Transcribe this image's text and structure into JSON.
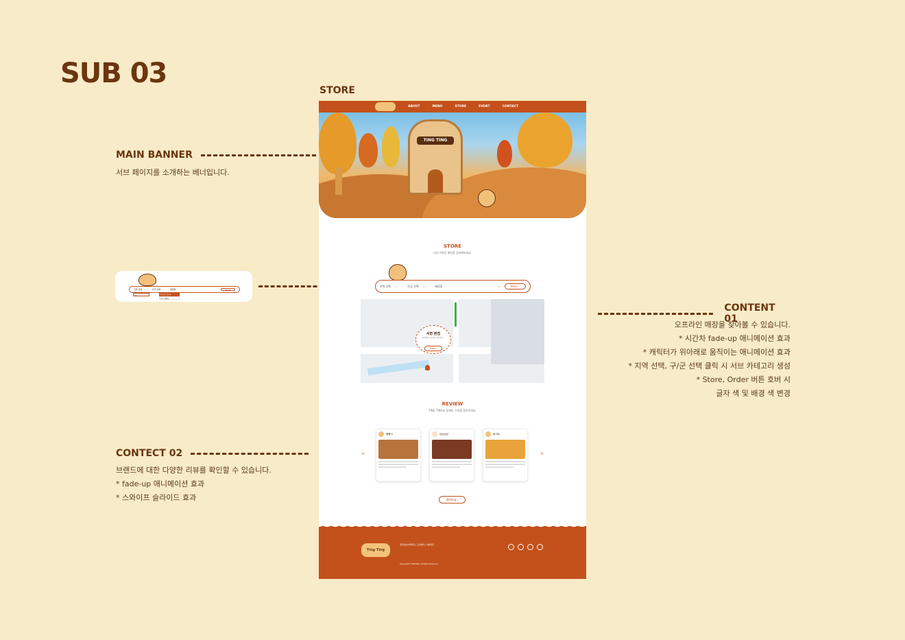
{
  "page": {
    "title": "SUB 03",
    "store_caption": "STORE"
  },
  "annotations": {
    "main_banner": {
      "title": "MAIN BANNER",
      "desc": "서브 페이지를 소개하는 베너입니다."
    },
    "content01": {
      "title": "CONTENT 01",
      "lines": [
        "오프라인 매장을 찾아볼 수 있습니다.",
        "* 시간차 fade-up 애니메이션 효과",
        "* 캐릭터가 위아래로 움직이는 애니메이션 효과",
        "* 지역 선택, 구/군 선택 클릭 시 서브 카테고리 생성",
        "* Store, Order 버튼 호버 시",
        "글자 색 및 배경 색 변경"
      ]
    },
    "contect02": {
      "title": "CONTECT 02",
      "lines": [
        "브랜드에 대한 다양한 리뷰를 확인할 수 있습니다.",
        "* fade-up 애니메이션 효과",
        "* 스와이프 슬라이드 효과"
      ]
    }
  },
  "mockup": {
    "nav": [
      "ABOUT",
      "MENU",
      "STORE",
      "EVENT",
      "CONTACT"
    ],
    "banner_sign": "TING TING",
    "store_section": {
      "title": "STORE",
      "subtitle": "나와 가까운 매장을 검색해보세요."
    },
    "search": {
      "region": "지역 선택",
      "district": "구/군 선택",
      "placeholder": "매장명",
      "button": "Store"
    },
    "map_popup": {
      "name": "서면 본점",
      "addr": "부산광역시 부산진구 전포대로 ...",
      "button": "Order"
    },
    "review_section": {
      "title": "REVIEW",
      "subtitle": "TING TING과 함께한 기억을 알려주세요.",
      "prev": "<",
      "next": ">",
      "write_button": "Writing"
    },
    "reviews": [
      {
        "user": "빵빵이"
      },
      {
        "user": "냠냠냠냠"
      },
      {
        "user": "베그베"
      }
    ],
    "footer": {
      "logo": "Ting Ting",
      "links": "개인정보처리방침 | 고객센터 | 이용약관",
      "copyright": "Copyright© TINGTING. All Rights Reserved"
    },
    "mini_dropdown": {
      "item1": "부산진구 전포동",
      "item2": "동구 범일동",
      "region": "지역 선택",
      "district": "구/군 선택",
      "selected": "부산",
      "placeholder": "매장명",
      "button": "Start"
    }
  },
  "colors": {
    "brand": "#c4511c",
    "background": "#f8ebc7",
    "heading": "#6b3510"
  },
  "icons": [
    "search-icon",
    "chevron-down-icon",
    "instagram-icon",
    "youtube-icon",
    "facebook-icon",
    "x-icon",
    "arrow-right-icon"
  ]
}
